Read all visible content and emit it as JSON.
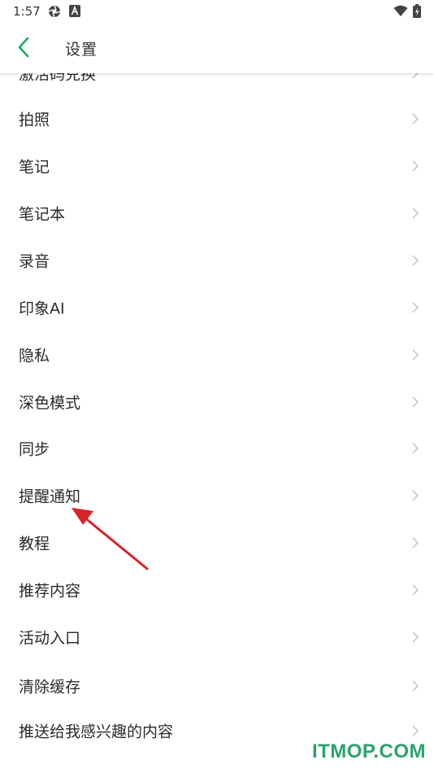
{
  "status_bar": {
    "time": "1:57",
    "icons": [
      "aperture-icon",
      "a-badge-icon",
      "wifi-icon",
      "battery-icon"
    ]
  },
  "header": {
    "title": "设置",
    "back_icon": "chevron-left-icon",
    "accent_color": "#1aad5e"
  },
  "settings": {
    "items": [
      {
        "label": "激活码兑换"
      },
      {
        "label": "拍照"
      },
      {
        "label": "笔记"
      },
      {
        "label": "笔记本"
      },
      {
        "label": "录音"
      },
      {
        "label": "印象AI"
      },
      {
        "label": "隐私"
      },
      {
        "label": "深色模式"
      },
      {
        "label": "同步"
      },
      {
        "label": "提醒通知"
      },
      {
        "label": "教程"
      },
      {
        "label": "推荐内容"
      },
      {
        "label": "活动入口"
      },
      {
        "label": "清除缓存"
      },
      {
        "label": "推送给我感兴趣的内容"
      }
    ]
  },
  "annotation": {
    "arrow_color": "#d9232a",
    "points_to": "提醒通知"
  },
  "watermark": {
    "text": "ITMOP.COM",
    "color": "#2aa36b"
  }
}
